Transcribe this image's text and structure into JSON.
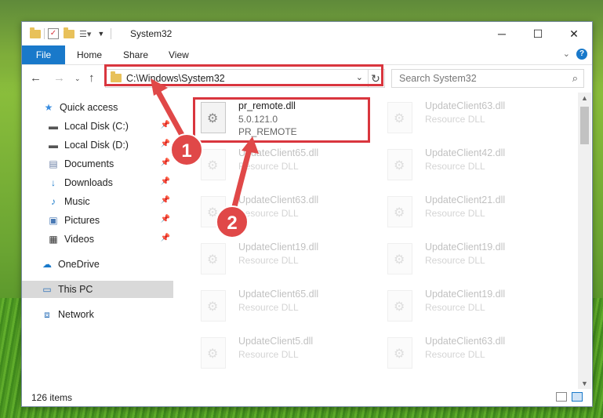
{
  "window": {
    "title": "System32",
    "minimize": "─",
    "maximize": "☐",
    "close": "✕"
  },
  "ribbon": {
    "file": "File",
    "home": "Home",
    "share": "Share",
    "view": "View",
    "help": "?"
  },
  "address": {
    "path": "C:\\Windows\\System32",
    "search_placeholder": "Search System32"
  },
  "nav_pane": {
    "quick_access": "Quick access",
    "local_c": "Local Disk (C:)",
    "local_d": "Local Disk (D:)",
    "documents": "Documents",
    "downloads": "Downloads",
    "music": "Music",
    "pictures": "Pictures",
    "videos": "Videos",
    "onedrive": "OneDrive",
    "this_pc": "This PC",
    "network": "Network"
  },
  "files": {
    "main": {
      "name": "pr_remote.dll",
      "version": "5.0.121.0",
      "desc": "PR_REMOTE"
    },
    "left": [
      {
        "name": "UpdateClient65.dll",
        "desc": "Resource DLL"
      },
      {
        "name": "UpdateClient63.dll",
        "desc": "Resource DLL"
      },
      {
        "name": "UpdateClient19.dll",
        "desc": "Resource DLL"
      },
      {
        "name": "UpdateClient65.dll",
        "desc": "Resource DLL"
      },
      {
        "name": "UpdateClient5.dll",
        "desc": "Resource DLL"
      }
    ],
    "right": [
      {
        "name": "UpdateClient63.dll",
        "desc": "Resource DLL"
      },
      {
        "name": "UpdateClient42.dll",
        "desc": "Resource DLL"
      },
      {
        "name": "UpdateClient21.dll",
        "desc": "Resource DLL"
      },
      {
        "name": "UpdateClient19.dll",
        "desc": "Resource DLL"
      },
      {
        "name": "UpdateClient19.dll",
        "desc": "Resource DLL"
      },
      {
        "name": "UpdateClient63.dll",
        "desc": "Resource DLL"
      }
    ]
  },
  "status": {
    "count": "126 items"
  },
  "annotations": {
    "marker1": "1",
    "marker2": "2",
    "color": "#d9363e"
  }
}
